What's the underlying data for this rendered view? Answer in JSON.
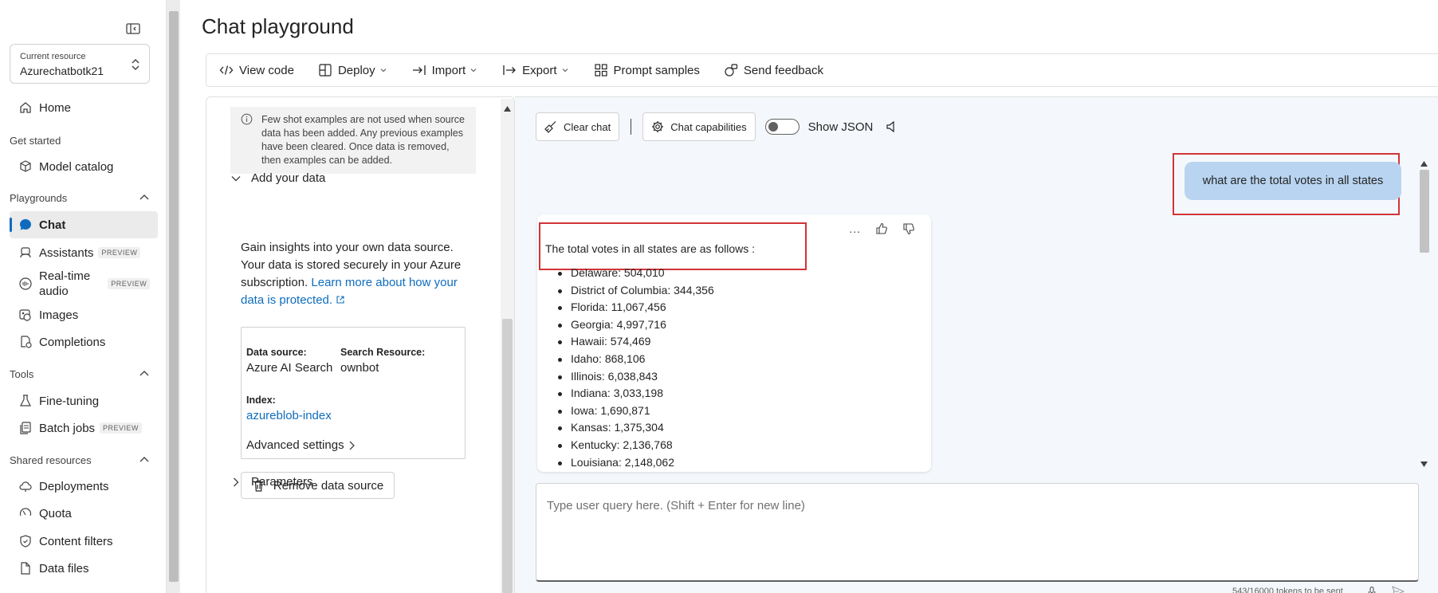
{
  "sidebar": {
    "resource_caption": "Current resource",
    "resource_name": "Azurechatbotk21",
    "home": "Home",
    "sections": {
      "get_started": "Get started",
      "playgrounds": "Playgrounds",
      "tools": "Tools",
      "shared_resources": "Shared resources"
    },
    "items": {
      "model_catalog": "Model catalog",
      "chat": "Chat",
      "assistants": "Assistants",
      "realtime_audio_line1": "Real-time",
      "realtime_audio_line2": "audio",
      "images": "Images",
      "completions": "Completions",
      "fine_tuning": "Fine-tuning",
      "batch_jobs": "Batch jobs",
      "deployments": "Deployments",
      "quota": "Quota",
      "content_filters": "Content filters",
      "data_files": "Data files"
    },
    "preview_badge": "PREVIEW"
  },
  "header": {
    "title": "Chat playground"
  },
  "toolbar": {
    "view_code": "View code",
    "deploy": "Deploy",
    "import": "Import",
    "export": "Export",
    "prompt_samples": "Prompt samples",
    "send_feedback": "Send feedback"
  },
  "setup": {
    "fewshot_notice": "Few shot examples are not used when source data has been added. Any previous examples have been cleared. Once data is removed, then examples can be added.",
    "add_your_data": "Add your data",
    "description": "Gain insights into your own data source. Your data is stored securely in your Azure subscription.",
    "learn_more_link": "Learn more about how your data is protected.",
    "data_source_label": "Data source:",
    "data_source_value": "Azure AI Search",
    "search_resource_label": "Search Resource:",
    "search_resource_value": "ownbot",
    "index_label": "Index:",
    "index_value": "azureblob-index",
    "advanced_settings": "Advanced settings",
    "remove_data_source": "Remove data source",
    "parameters": "Parameters"
  },
  "chat": {
    "clear_chat": "Clear chat",
    "chat_capabilities": "Chat capabilities",
    "show_json": "Show JSON",
    "show_json_on": false,
    "user_message": "what are the total votes in all states",
    "assistant_intro": "The total votes in all states are as follows :",
    "assistant_list": [
      "Delaware: 504,010",
      "District of Columbia: 344,356",
      "Florida: 11,067,456",
      "Georgia: 4,997,716",
      "Hawaii: 574,469",
      "Idaho: 868,106",
      "Illinois: 6,038,843",
      "Indiana: 3,033,198",
      "Iowa: 1,690,871",
      "Kansas: 1,375,304",
      "Kentucky: 2,136,768",
      "Louisiana: 2,148,062"
    ],
    "more_actions": "...",
    "query_placeholder": "Type user query here. (Shift + Enter for new line)",
    "token_count": "543/16000 tokens to be sent"
  },
  "colors": {
    "accent": "#0f6cbd",
    "user_bubble": "#b8d4f0",
    "highlight": "#d13438",
    "chat_bg": "#f4f8fc"
  }
}
